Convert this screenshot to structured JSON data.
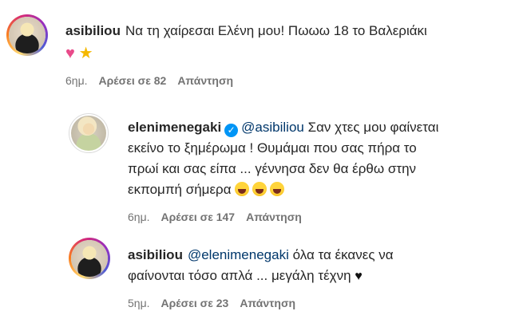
{
  "comments": [
    {
      "username": "asibiliou",
      "text": "Να τη χαίρεσαι Ελένη μου! Πωωω 18 το Βαλεριάκι",
      "time": "6ημ.",
      "likes": "Αρέσει σε 82",
      "reply": "Απάντηση",
      "emojis": [
        "pink-heart",
        "star"
      ]
    },
    {
      "username": "elenimenegaki",
      "verified": true,
      "mention": "@asibiliou",
      "line1": "Σαν χτες μου φαίνεται",
      "line2": "εκείνο το ξημέρωμα ! Θυμάμαι που σας πήρα το",
      "line3": "πρωί και σας είπα ... γέννησα δεν θα έρθω στην",
      "line4": "εκπομπή σήμερα",
      "time": "6ημ.",
      "likes": "Αρέσει σε 147",
      "reply": "Απάντηση",
      "emojis": [
        "laughing-face",
        "laughing-face",
        "laughing-face"
      ]
    },
    {
      "username": "asibiliou",
      "mention": "@elenimenegaki",
      "line1": "όλα τα έκανες να",
      "line2": "φαίνονται τόσο απλά ... μεγάλη τέχνη",
      "time": "5ημ.",
      "likes": "Αρέσει σε 23",
      "reply": "Απάντηση",
      "emojis": [
        "black-heart"
      ]
    }
  ]
}
